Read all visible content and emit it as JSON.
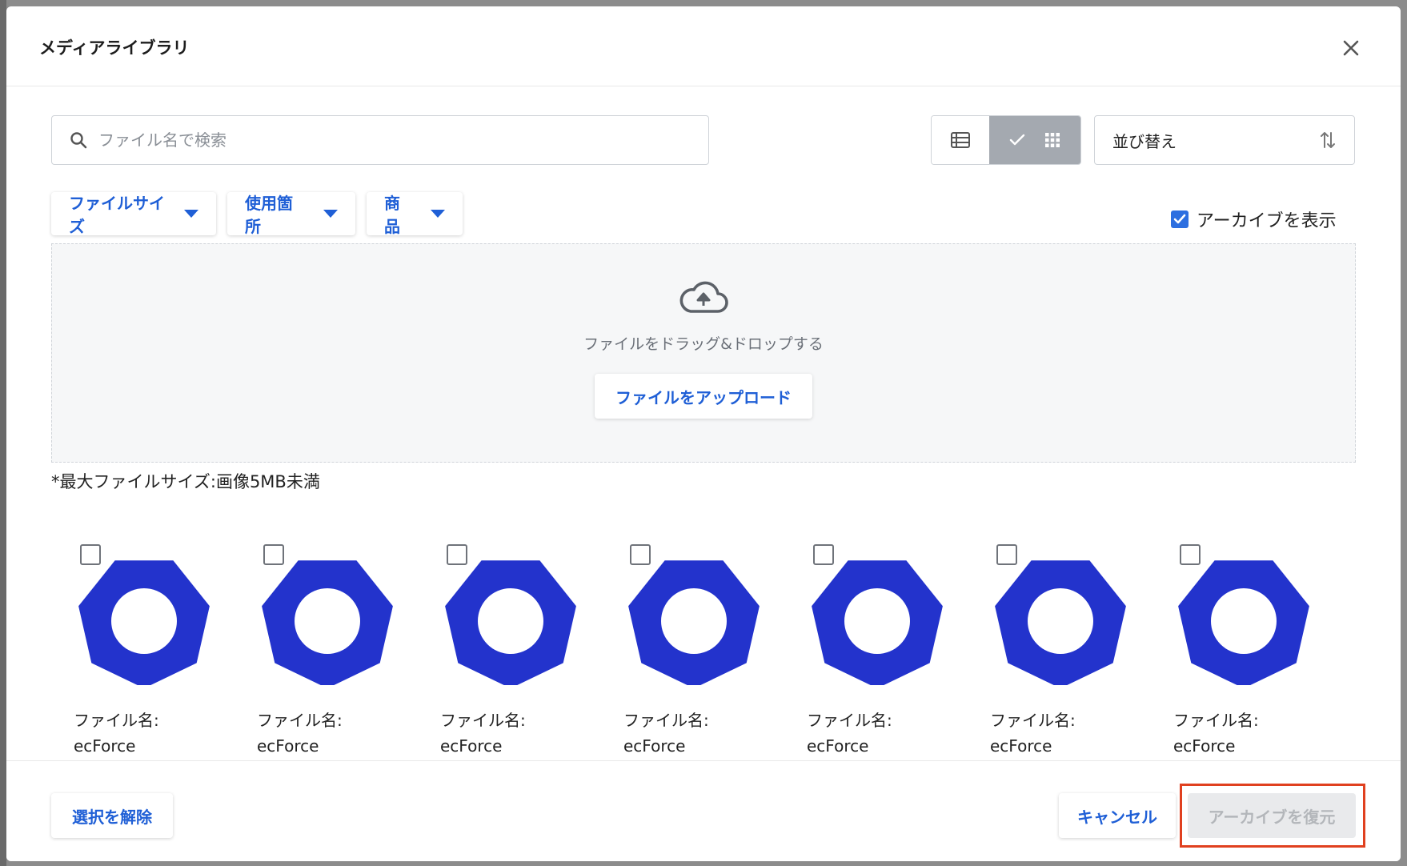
{
  "modal": {
    "title": "メディアライブラリ"
  },
  "search": {
    "placeholder": "ファイル名で検索",
    "value": ""
  },
  "view_toggle": {
    "active": "grid"
  },
  "sort": {
    "label": "並び替え"
  },
  "filters": [
    {
      "label": "ファイルサイズ"
    },
    {
      "label": "使用箇所"
    },
    {
      "label": "商品"
    }
  ],
  "archive_toggle": {
    "label": "アーカイブを表示",
    "checked": true
  },
  "dropzone": {
    "text": "ファイルをドラッグ&ドロップする",
    "upload_label": "ファイルをアップロード"
  },
  "size_note": "*最大ファイルサイズ:画像5MB未満",
  "files": [
    {
      "label": "ファイル名:",
      "name": "ecForce",
      "checked": false
    },
    {
      "label": "ファイル名:",
      "name": "ecForce",
      "checked": false
    },
    {
      "label": "ファイル名:",
      "name": "ecForce",
      "checked": false
    },
    {
      "label": "ファイル名:",
      "name": "ecForce",
      "checked": false
    },
    {
      "label": "ファイル名:",
      "name": "ecForce",
      "checked": false
    },
    {
      "label": "ファイル名:",
      "name": "ecForce",
      "checked": false
    },
    {
      "label": "ファイル名:",
      "name": "ecForce",
      "checked": false
    }
  ],
  "footer": {
    "clear_label": "選択を解除",
    "cancel_label": "キャンセル",
    "restore_label": "アーカイブを復元"
  },
  "colors": {
    "accent": "#1f5fd6",
    "thumbnail": "#2333cc",
    "highlight": "#e0401f"
  }
}
